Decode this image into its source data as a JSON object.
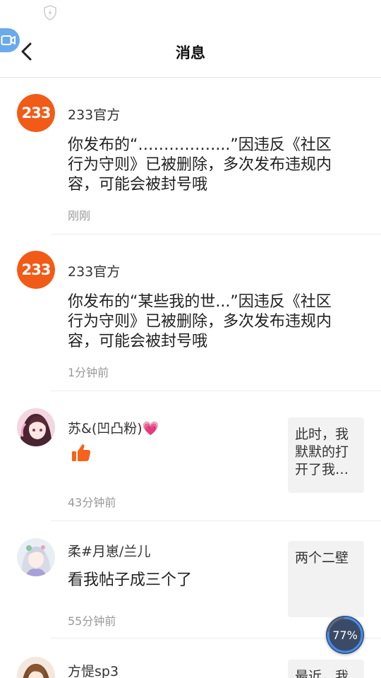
{
  "header": {
    "title": "消息"
  },
  "messages": [
    {
      "sender": "233官方",
      "avatar_text": "233",
      "body": "你发布的“……………...”因违反《社区行为守则》已被删除，多次发布违规内容，可能会被封号哦",
      "time": "刚刚"
    },
    {
      "sender": "233官方",
      "avatar_text": "233",
      "body": "你发布的“某些我的世...”因违反《社区行为守则》已被删除，多次发布违规内容，可能会被封号哦",
      "time": "1分钟前"
    },
    {
      "sender": "苏&(凹凸粉)",
      "sender_emoji": "💗",
      "body_icon": "thumbs-up-icon",
      "time": "43分钟前",
      "thumb_text": "此时，我默默的打开了我…"
    },
    {
      "sender": "柔#月崽/兰儿",
      "body": "看我帖子成三个了",
      "time": "55分钟前",
      "thumb_text": "两个二壁"
    },
    {
      "sender": "方惿sp3",
      "thumb_text": "最近，我"
    }
  ],
  "overlay": {
    "progress_label": "77%",
    "progress": 0.77
  },
  "colors": {
    "brand_orange": "#f25a17",
    "like_orange": "#f5631c",
    "camera_blue": "#6aa9ec"
  },
  "icons": {
    "status": "shield-bolt-icon",
    "camera": "video-camera-icon",
    "back": "chevron-left-icon"
  }
}
